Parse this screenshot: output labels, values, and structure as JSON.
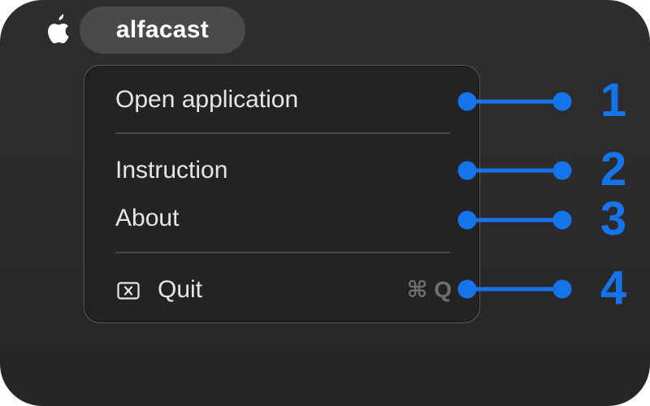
{
  "menubar": {
    "app_name": "alfacast",
    "apple_icon": "apple-logo-icon"
  },
  "menu": {
    "items": [
      {
        "label": "Open application"
      },
      {
        "label": "Instruction"
      },
      {
        "label": "About"
      },
      {
        "label": "Quit",
        "icon": "close-square-icon",
        "shortcut": "⌘ Q"
      }
    ]
  },
  "callouts": {
    "numbers": [
      "1",
      "2",
      "3",
      "4"
    ],
    "color": "#1674ea"
  },
  "colors": {
    "window_bg": "#2c2c2e",
    "menu_bg": "#232325",
    "pill_bg": "#4a4a4c",
    "text": "#e6e6e6"
  }
}
